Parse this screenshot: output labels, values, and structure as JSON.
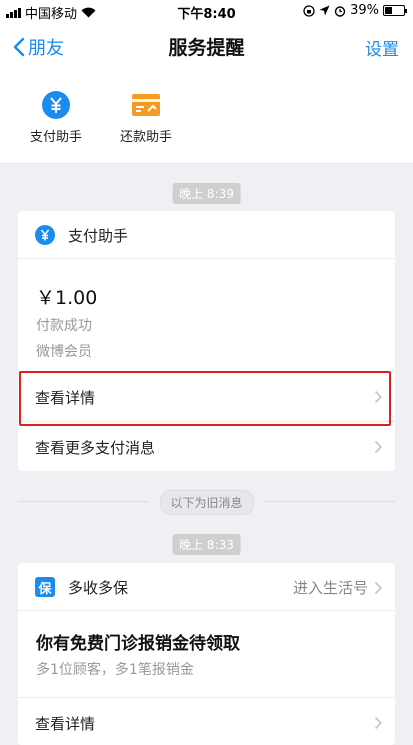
{
  "status_bar": {
    "carrier": "中国移动",
    "time": "下午8:40",
    "battery": "39%",
    "battery_level": 0.39
  },
  "nav": {
    "back_label": "朋友",
    "title": "服务提醒",
    "settings_label": "设置"
  },
  "assistants": [
    {
      "label": "支付助手",
      "icon": "yuan-circle-icon",
      "color": "#1a8cf0"
    },
    {
      "label": "还款助手",
      "icon": "card-repay-icon",
      "color": "#f59a23"
    }
  ],
  "messages": {
    "time1": "晚上 8:39",
    "card1": {
      "name": "支付助手",
      "amount": "￥1.00",
      "line1": "付款成功",
      "line2": "微博会员",
      "detail_label": "查看详情",
      "more_label": "查看更多支付消息"
    },
    "old_divider": "以下为旧消息",
    "time2": "晚上 8:33",
    "card2": {
      "badge": "保",
      "name": "多收多保",
      "enter_label": "进入生活号",
      "headline": "你有免费门诊报销金待领取",
      "line1": "多1位顾客，多1笔报销金",
      "detail_label": "查看详情"
    }
  },
  "colors": {
    "accent": "#1a8cf0",
    "highlight": "#e02020",
    "repay": "#f59a23"
  }
}
